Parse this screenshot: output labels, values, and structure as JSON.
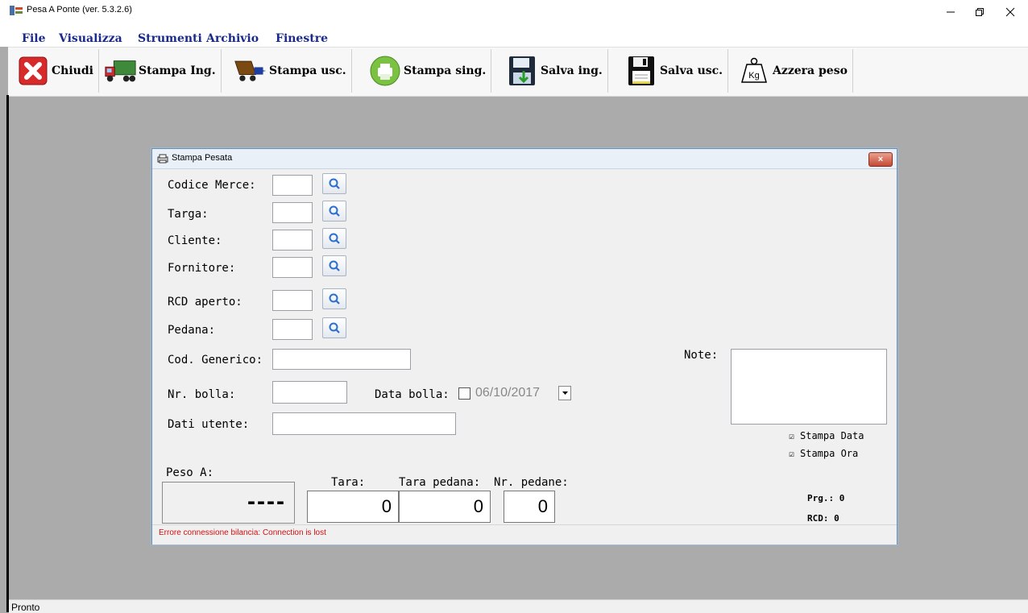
{
  "window": {
    "title": "Pesa A Ponte (ver. 5.3.2.6)"
  },
  "menu": [
    "File",
    "Visualizza",
    "Strumenti",
    "Archivio",
    "Finestre"
  ],
  "toolbar": [
    {
      "label": "Chiudi",
      "icon": "close-red-icon"
    },
    {
      "label": "Stampa Ing.",
      "icon": "truck-in-icon"
    },
    {
      "label": "Stampa usc.",
      "icon": "truck-out-icon"
    },
    {
      "label": "Stampa sing.",
      "icon": "printer-icon"
    },
    {
      "label": "Salva ing.",
      "icon": "save-in-icon"
    },
    {
      "label": "Salva usc.",
      "icon": "save-out-icon"
    },
    {
      "label": "Azzera peso",
      "icon": "weight-kg-icon",
      "icon_text": "Kg"
    }
  ],
  "dialog": {
    "title": "Stampa Pesata",
    "close_label": "×",
    "fields": {
      "codice_merce": "Codice Merce:",
      "targa": "Targa:",
      "cliente": "Cliente:",
      "fornitore": "Fornitore:",
      "rcd_aperto": "RCD aperto:",
      "pedana": "Pedana:",
      "cod_generico": "Cod. Generico:",
      "nr_bolla": "Nr. bolla:",
      "data_bolla": "Data bolla:",
      "dati_utente": "Dati utente:",
      "note": "Note:"
    },
    "data_bolla_value": "06/10/2017",
    "checkboxes": [
      {
        "label": "Stampa Data",
        "checked": true,
        "mark": "☑"
      },
      {
        "label": "Stampa Ora",
        "checked": true,
        "mark": "☑"
      }
    ],
    "peso_a_label": "Peso A:",
    "peso_a_value": "----",
    "tara_label": "Tara:",
    "tara_value": "0",
    "tara_pedana_label": "Tara pedana:",
    "tara_pedana_value": "0",
    "nr_pedane_label": "Nr. pedane:",
    "nr_pedane_value": "0",
    "prg": "Prg.: 0",
    "rcd": "RCD: 0",
    "error": "Errore connessione bilancia: Connection is lost"
  },
  "status": "Pronto"
}
